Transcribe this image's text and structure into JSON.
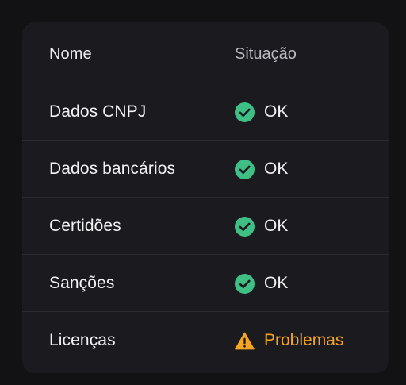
{
  "colors": {
    "ok": "#3fbf86",
    "warning": "#f5a524",
    "background": "#121215",
    "card": "#1b1b1f"
  },
  "table": {
    "headers": {
      "name": "Nome",
      "status": "Situação"
    },
    "rows": [
      {
        "name": "Dados CNPJ",
        "status": "OK",
        "icon": "check-circle-icon"
      },
      {
        "name": "Dados bancários",
        "status": "OK",
        "icon": "check-circle-icon"
      },
      {
        "name": "Certidões",
        "status": "OK",
        "icon": "check-circle-icon"
      },
      {
        "name": "Sanções",
        "status": "OK",
        "icon": "check-circle-icon"
      },
      {
        "name": "Licenças",
        "status": "Problemas",
        "icon": "warning-triangle-icon"
      }
    ]
  }
}
